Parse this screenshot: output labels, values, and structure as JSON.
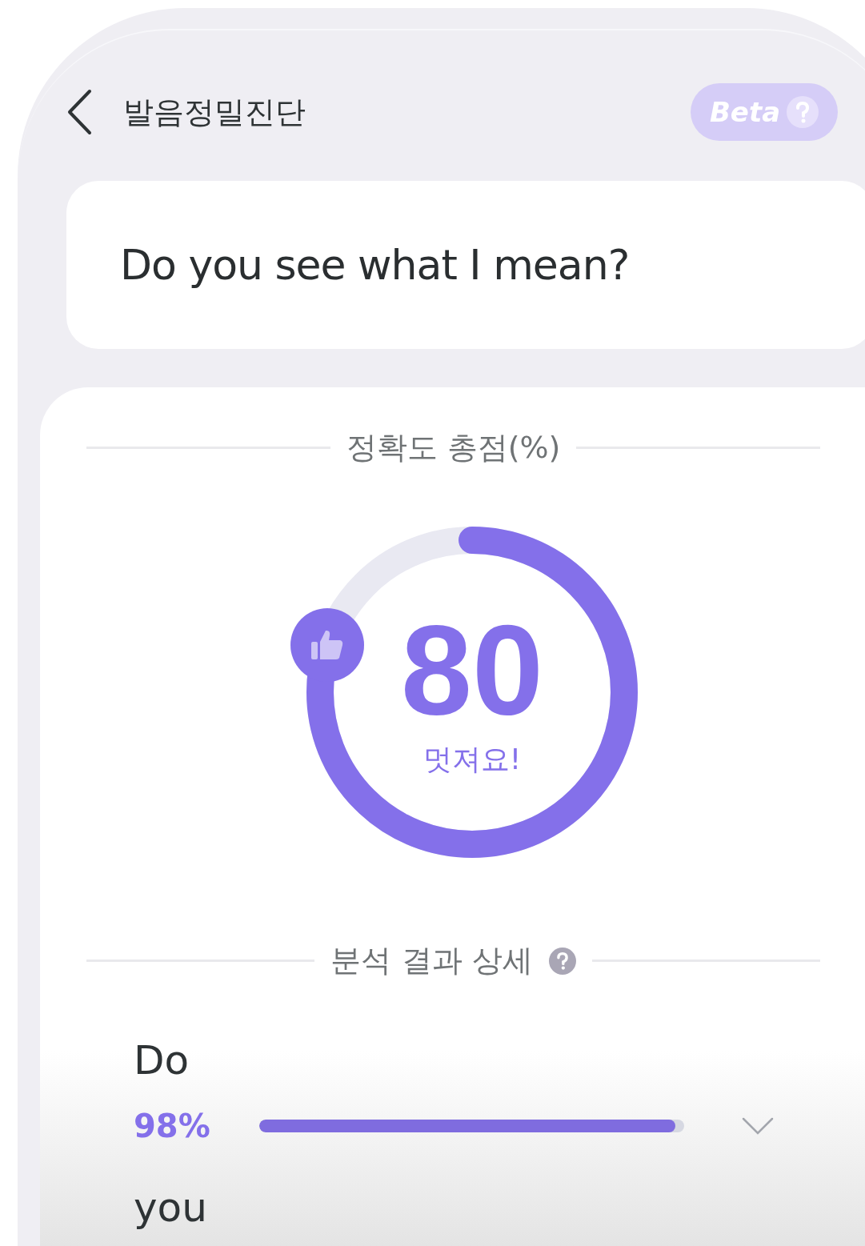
{
  "header": {
    "title": "발음정밀진단",
    "badge": {
      "label": "Beta"
    }
  },
  "sentence": "Do you see what I mean?",
  "score_section": {
    "heading": "정확도 총점(%)",
    "score": "80",
    "level": 0.8,
    "comment": "멋져요!"
  },
  "detail_section": {
    "heading": "분석 결과 상세",
    "words": [
      {
        "word": "Do",
        "percent": "98%",
        "level": 0.98,
        "expanded": false
      },
      {
        "word": "you"
      }
    ]
  }
}
